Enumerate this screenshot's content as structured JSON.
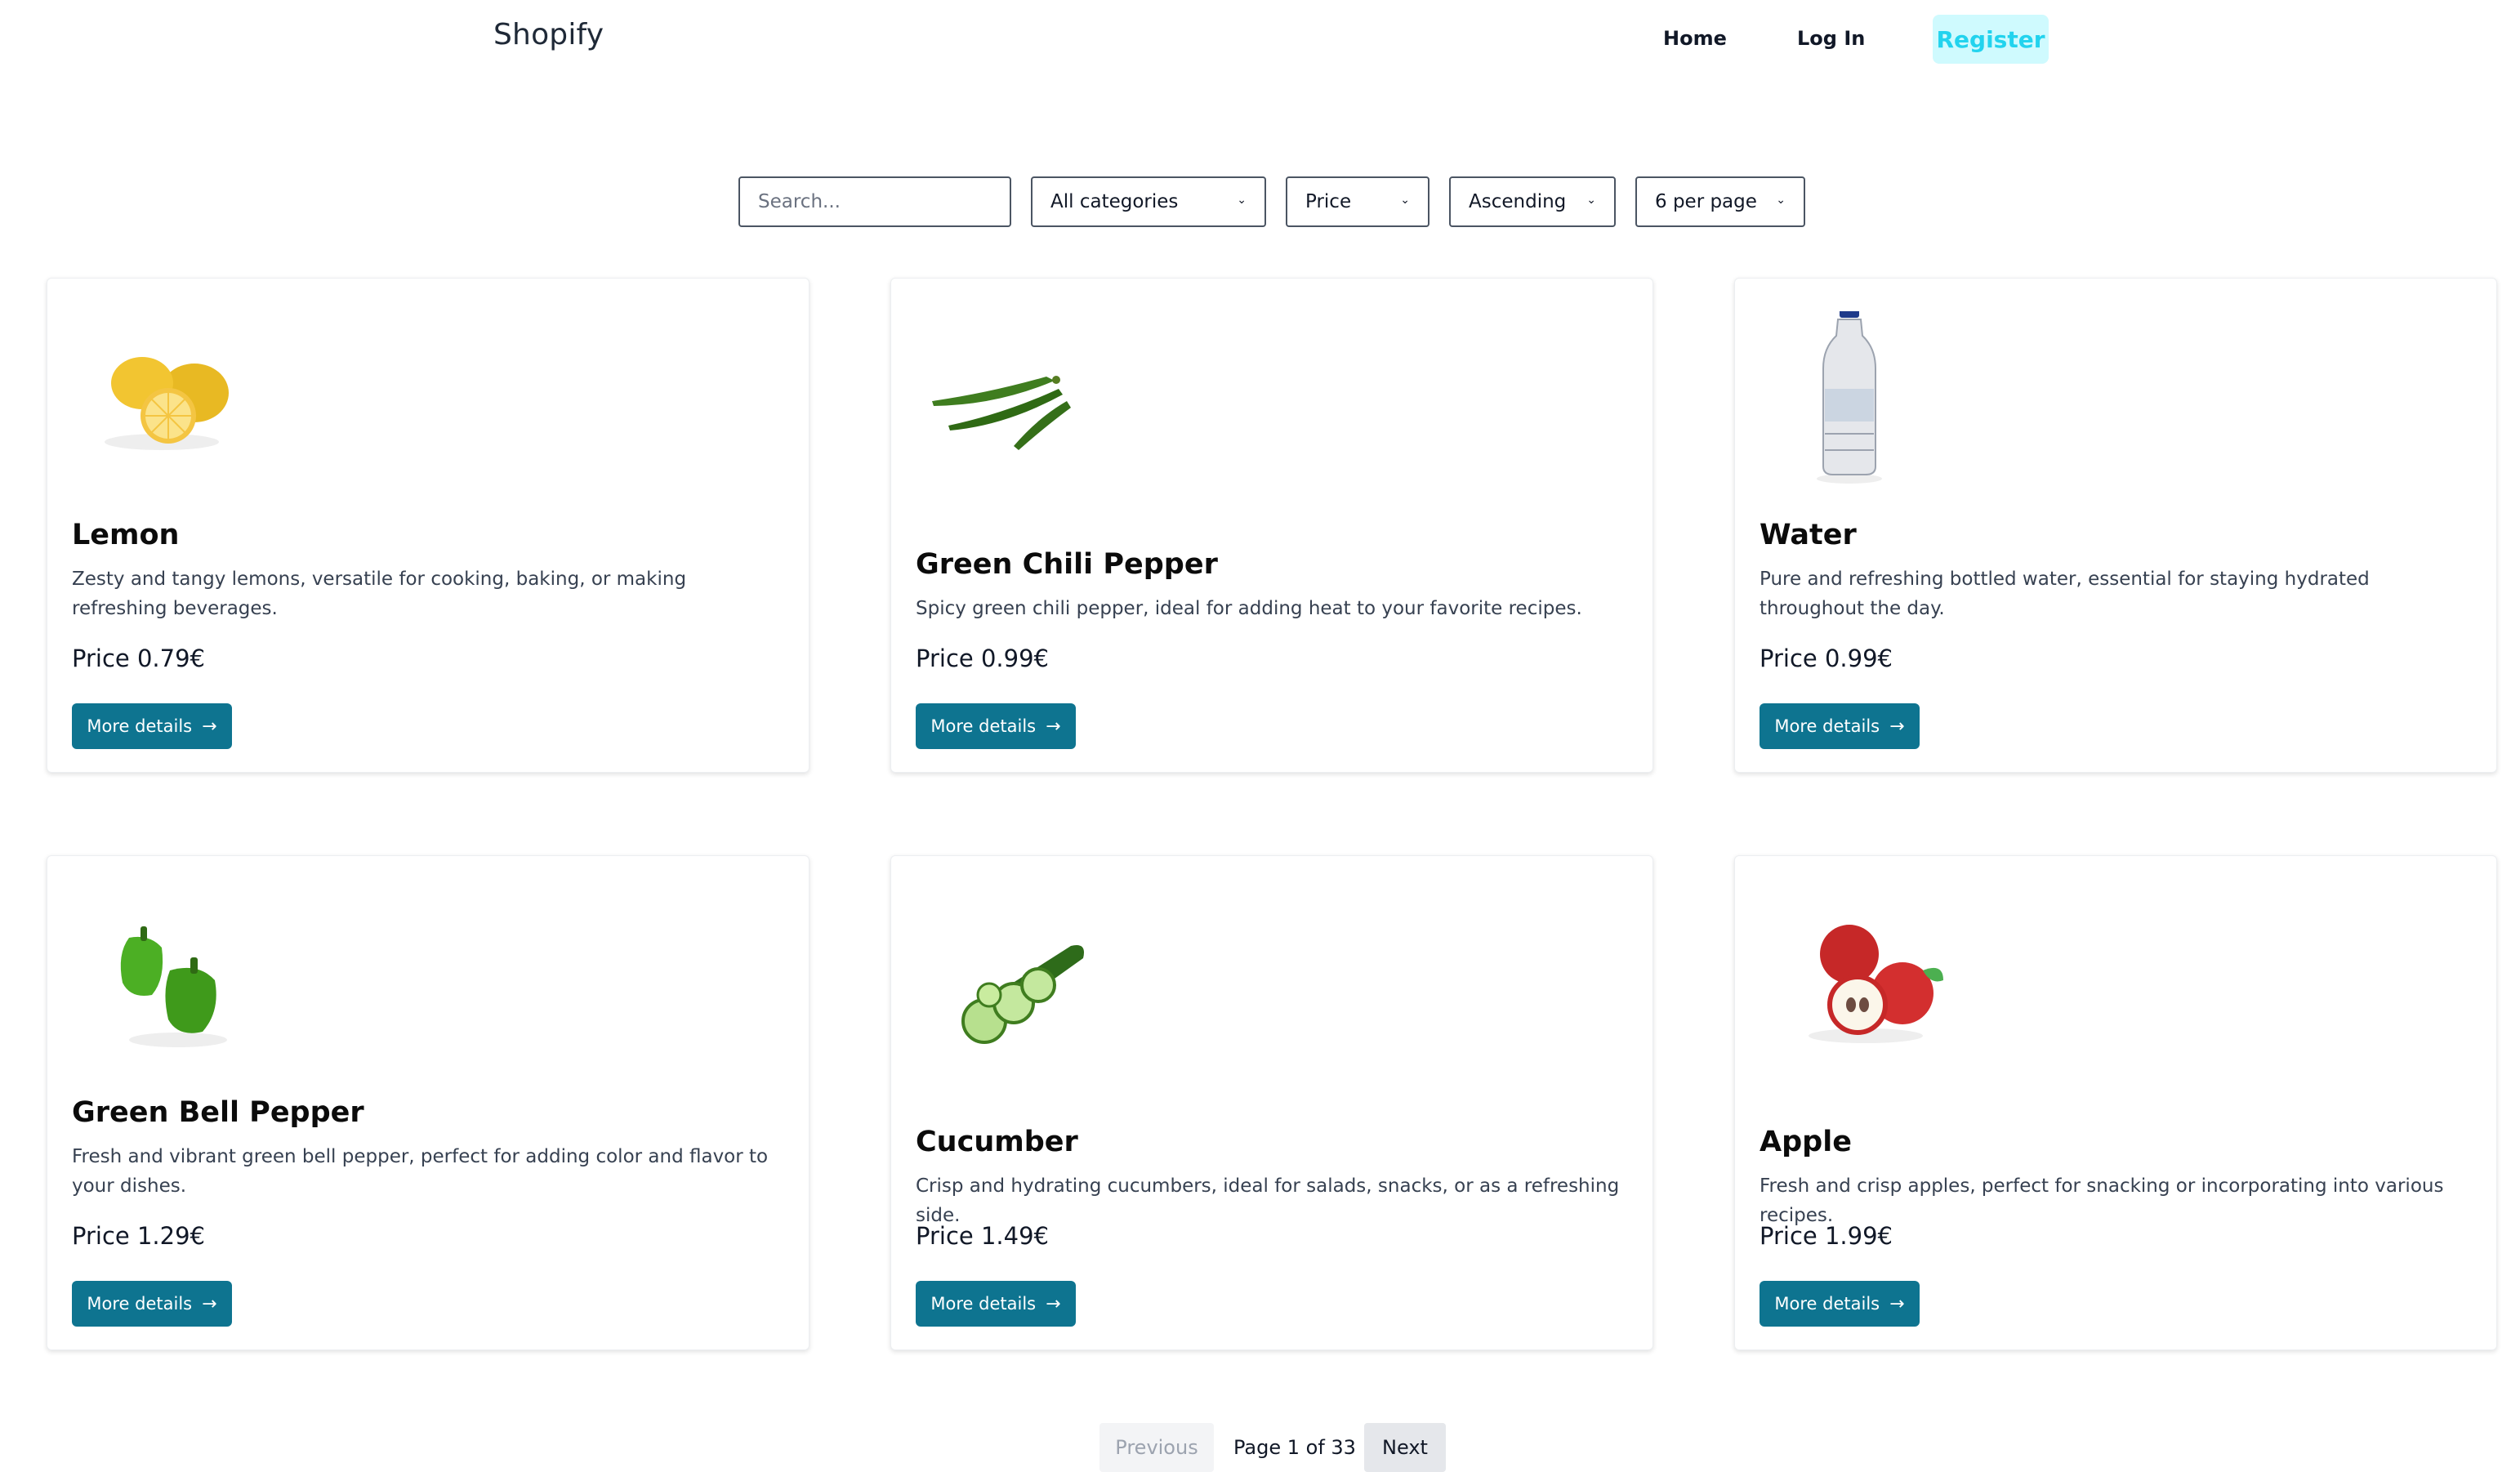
{
  "header": {
    "brand": "Shopify",
    "nav": {
      "home": "Home",
      "login": "Log In",
      "register": "Register"
    }
  },
  "filters": {
    "search_placeholder": "Search...",
    "category": "All categories",
    "sort_by": "Price",
    "order": "Ascending",
    "per_page": "6 per page"
  },
  "products": [
    {
      "name": "Lemon",
      "description": "Zesty and tangy lemons, versatile for cooking, baking, or making refreshing beverages.",
      "price": "Price 0.79€",
      "button": "More details"
    },
    {
      "name": "Green Chili Pepper",
      "description": "Spicy green chili pepper, ideal for adding heat to your favorite recipes.",
      "price": "Price 0.99€",
      "button": "More details"
    },
    {
      "name": "Water",
      "description": "Pure and refreshing bottled water, essential for staying hydrated throughout the day.",
      "price": "Price 0.99€",
      "button": "More details"
    },
    {
      "name": "Green Bell Pepper",
      "description": "Fresh and vibrant green bell pepper, perfect for adding color and flavor to your dishes.",
      "price": "Price 1.29€",
      "button": "More details"
    },
    {
      "name": "Cucumber",
      "description": "Crisp and hydrating cucumbers, ideal for salads, snacks, or as a refreshing side.",
      "price": "Price 1.49€",
      "button": "More details"
    },
    {
      "name": "Apple",
      "description": "Fresh and crisp apples, perfect for snacking or incorporating into various recipes.",
      "price": "Price 1.99€",
      "button": "More details"
    }
  ],
  "pagination": {
    "previous": "Previous",
    "info": "Page 1 of 33",
    "next": "Next"
  },
  "colors": {
    "button": "#0e7490",
    "register_bg": "#cffafe",
    "register_text": "#22d3ee"
  },
  "icons": {
    "details_button": "arrow-right-icon",
    "select": "chevron-down-icon"
  }
}
